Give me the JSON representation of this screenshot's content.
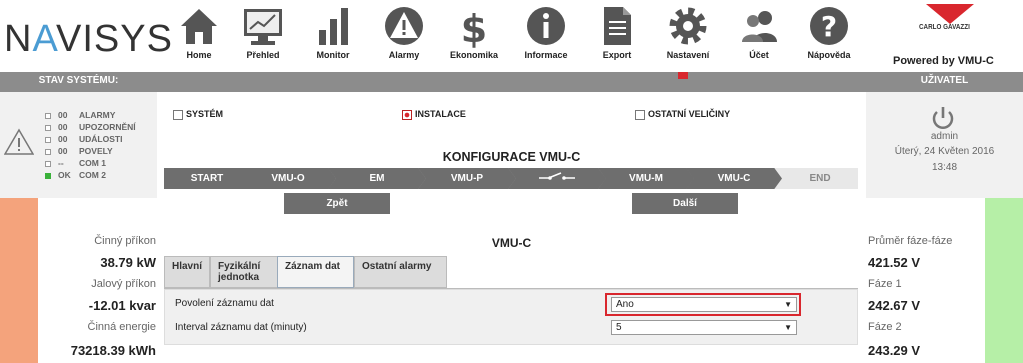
{
  "brand": {
    "logo_left": "N",
    "logo_a": "A",
    "logo_right": "VISYS",
    "vendor": "CARLO GAVAZZI",
    "powered_by": "Powered by  VMU-C"
  },
  "nav": [
    {
      "label": "Home",
      "icon": "home-icon"
    },
    {
      "label": "Přehled",
      "icon": "monitor-icon"
    },
    {
      "label": "Monitor",
      "icon": "bar-chart-icon"
    },
    {
      "label": "Alarmy",
      "icon": "warning-icon"
    },
    {
      "label": "Ekonomika",
      "icon": "dollar-icon"
    },
    {
      "label": "Informace",
      "icon": "info-icon"
    },
    {
      "label": "Export",
      "icon": "document-icon"
    },
    {
      "label": "Nastavení",
      "icon": "gear-icon"
    },
    {
      "label": "Účet",
      "icon": "users-icon"
    },
    {
      "label": "Nápověda",
      "icon": "help-icon"
    }
  ],
  "status": {
    "header": "STAV SYSTÉMU:",
    "rows": [
      {
        "count": "00",
        "label": "ALARMY",
        "ok": false
      },
      {
        "count": "00",
        "label": "UPOZORNĚNÍ",
        "ok": false
      },
      {
        "count": "00",
        "label": "UDÁLOSTI",
        "ok": false
      },
      {
        "count": "00",
        "label": "POVELY",
        "ok": false
      },
      {
        "count": "--",
        "label": "COM 1",
        "ok": false
      },
      {
        "count": "OK",
        "label": "COM 2",
        "ok": true
      }
    ]
  },
  "user": {
    "header": "UŽIVATEL",
    "name": "admin",
    "date": "Úterý, 24 Květen 2016",
    "time": "13:48"
  },
  "filters": [
    {
      "label": "SYSTÉM",
      "checked": false
    },
    {
      "label": "INSTALACE",
      "checked": true
    },
    {
      "label": "OSTATNÍ VELIČINY",
      "checked": false
    }
  ],
  "wizard": {
    "title": "KONFIGURACE VMU-C",
    "steps": [
      "START",
      "VMU-O",
      "EM",
      "VMU-P",
      "switch-icon",
      "VMU-M",
      "VMU-C",
      "END"
    ],
    "back": "Zpět",
    "next": "Další"
  },
  "section_title": "VMU-C",
  "tabs": [
    {
      "label": "Hlavní",
      "active": false
    },
    {
      "label": "Fyzikální jednotka",
      "active": false
    },
    {
      "label": "Záznam dat",
      "active": true
    },
    {
      "label": "Ostatní alarmy",
      "active": false
    }
  ],
  "form": {
    "enable_label": "Povolení záznamu dat",
    "enable_value": "Ano",
    "interval_label": "Interval záznamu dat (minuty)",
    "interval_value": "5"
  },
  "left_metrics": [
    {
      "label": "Činný příkon",
      "value": "38.79 kW"
    },
    {
      "label": "Jalový příkon",
      "value": "-12.01 kvar"
    },
    {
      "label": "Činná energie",
      "value": "73218.39 kWh"
    }
  ],
  "right_metrics": [
    {
      "label": "Průměr fáze-fáze",
      "value": "421.52 V"
    },
    {
      "label": "Fáze 1",
      "value": "242.67 V"
    },
    {
      "label": "Fáze 2",
      "value": "243.29 V"
    }
  ],
  "colors": {
    "accent_red": "#d9272e",
    "gray_bar": "#8c8c8c",
    "step_dark": "#6e6e6e",
    "left_strip": "#f4a37c",
    "right_strip": "#b6efa7"
  }
}
